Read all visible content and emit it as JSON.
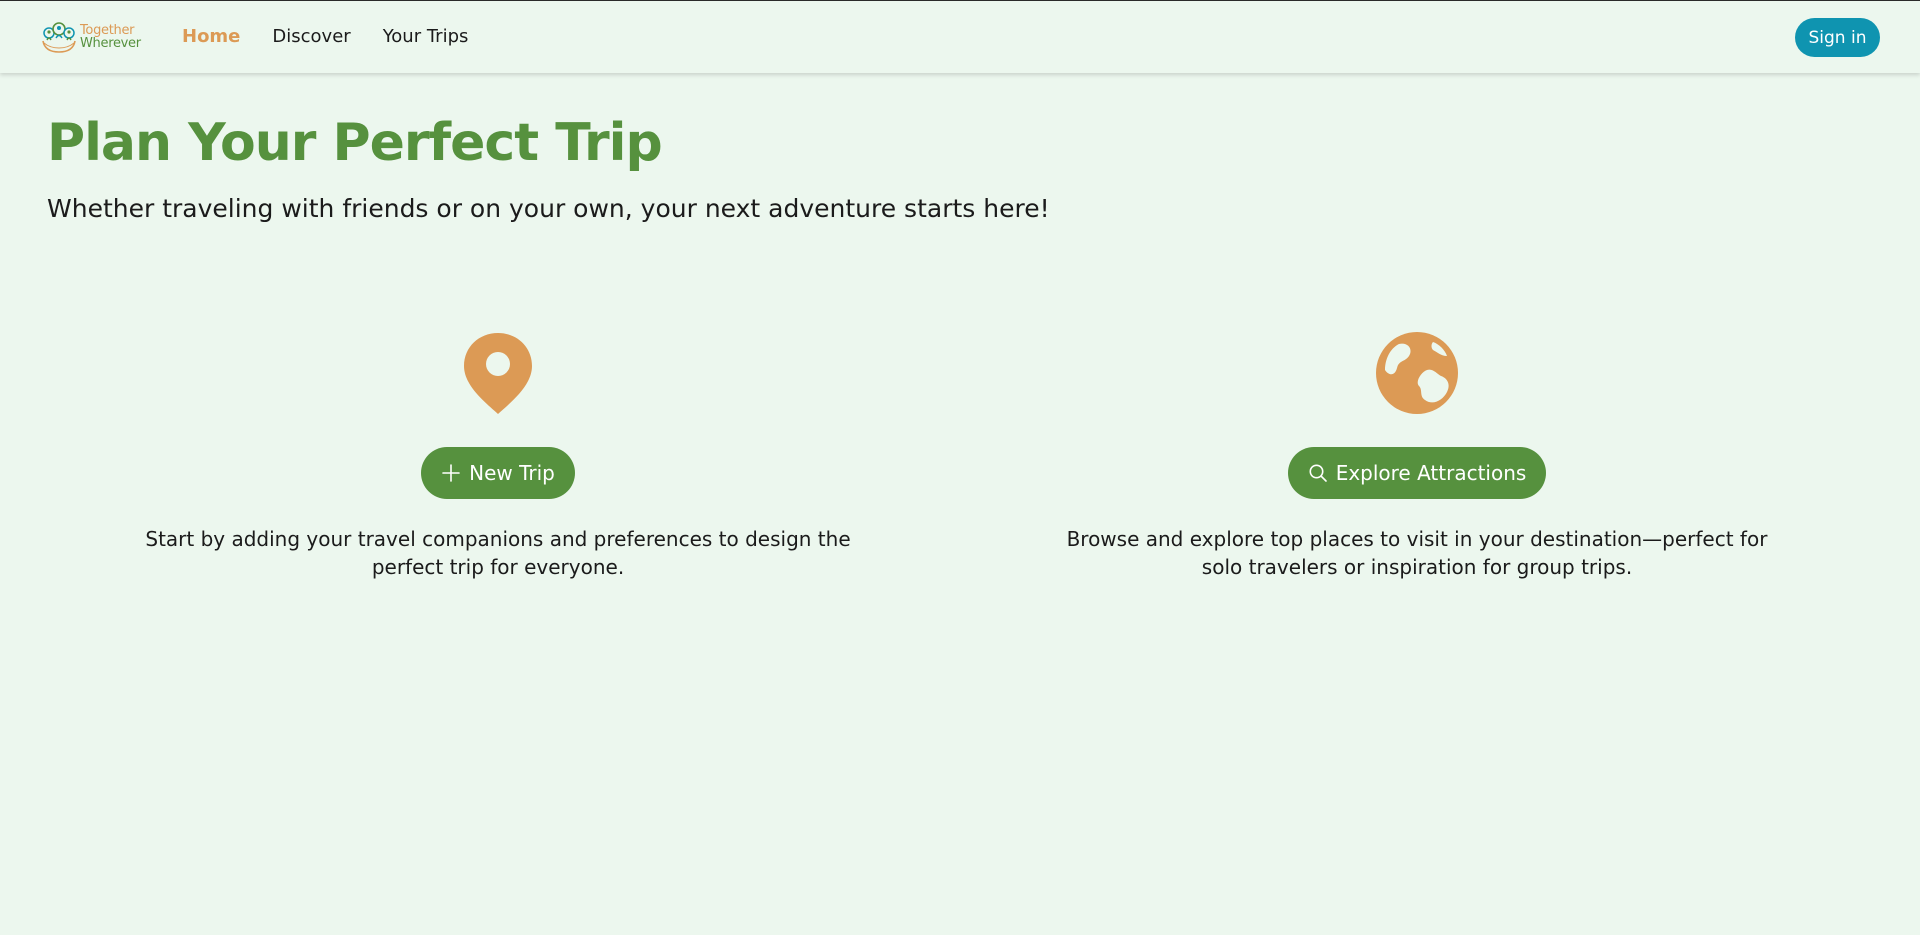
{
  "brand": {
    "name_line1": "Together",
    "name_line2": "Wherever"
  },
  "nav": {
    "items": [
      {
        "label": "Home",
        "active": true
      },
      {
        "label": "Discover",
        "active": false
      },
      {
        "label": "Your Trips",
        "active": false
      }
    ],
    "sign_in_label": "Sign in"
  },
  "hero": {
    "title": "Plan Your Perfect Trip",
    "subtitle": "Whether traveling with friends or on your own, your next adventure starts here!"
  },
  "features": [
    {
      "icon": "map-pin-icon",
      "button_label": "New Trip",
      "button_icon": "plus-icon",
      "description": "Start by adding your travel companions and preferences to design the perfect trip for everyone."
    },
    {
      "icon": "globe-icon",
      "button_label": "Explore Attractions",
      "button_icon": "search-icon",
      "description": "Browse and explore top places to visit in your destination—perfect for solo travelers or inspiration for group trips."
    }
  ],
  "colors": {
    "background": "#ecf7ee",
    "brand_green": "#56913e",
    "accent_orange": "#dc9a55",
    "sign_in_teal": "#0f94b0",
    "text": "#1b1b1b"
  }
}
